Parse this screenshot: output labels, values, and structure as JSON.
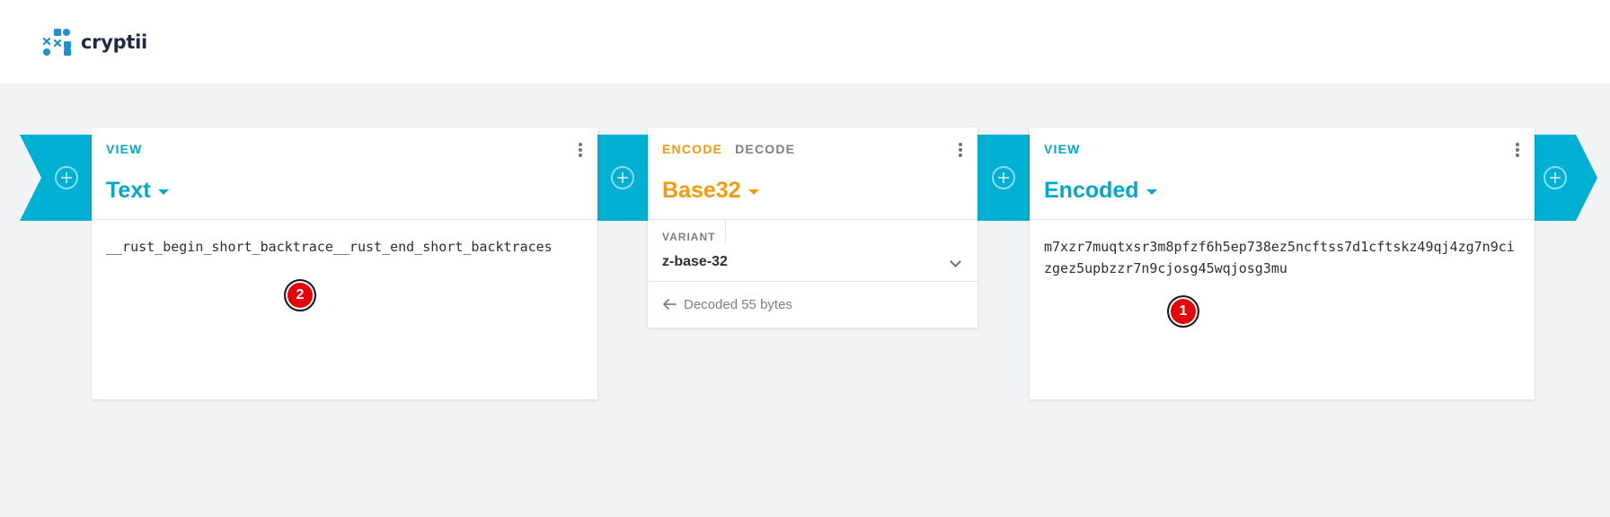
{
  "app": {
    "name": "cryptii",
    "logo_icon": "cryptii-logo-icon"
  },
  "colors": {
    "pipe": "#00b0d3",
    "view_accent": "#00a8cb",
    "encoder_accent": "#f59a0b",
    "marker": "#e8000b"
  },
  "pipes": [
    {
      "icon": "add-brick-icon"
    },
    {
      "icon": "add-brick-icon"
    },
    {
      "icon": "add-brick-icon"
    },
    {
      "icon": "add-brick-icon"
    }
  ],
  "left_view": {
    "tab": "VIEW",
    "title": "Text",
    "content": "__rust_begin_short_backtrace__rust_end_short_backtraces"
  },
  "encoder": {
    "tab_encode": "ENCODE",
    "tab_decode": "DECODE",
    "title": "Base32",
    "variant_label": "VARIANT",
    "variant_value": "z-base-32",
    "status": "Decoded 55 bytes",
    "status_icon": "arrow-left-icon"
  },
  "right_view": {
    "tab": "VIEW",
    "title": "Encoded",
    "content": "m7xzr7muqtxsr3m8pfzf6h5ep738ez5ncftss7d1cftskz49qj4zg7n9cizgez5upbzzr7n9cjosg45wqjosg3mu"
  },
  "markers": [
    {
      "label": "1"
    },
    {
      "label": "2"
    }
  ]
}
